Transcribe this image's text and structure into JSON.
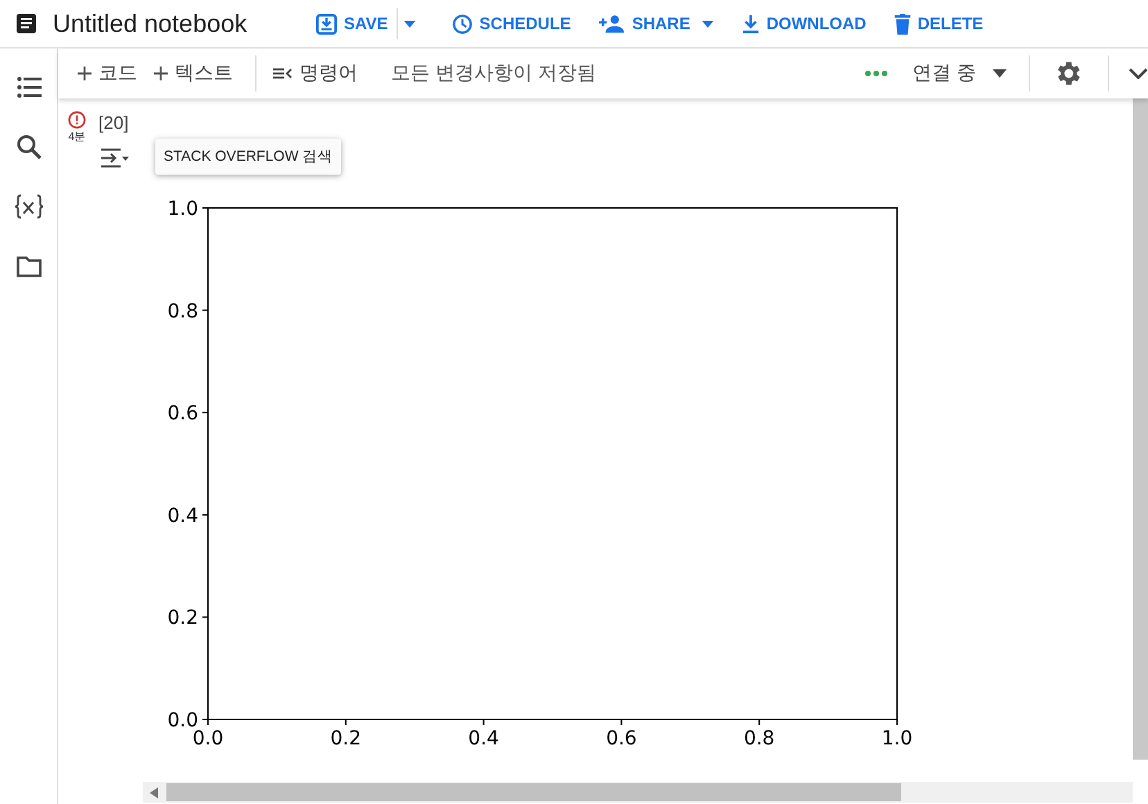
{
  "header": {
    "title": "Untitled notebook",
    "actions": [
      {
        "kind": "save",
        "label": "SAVE"
      },
      {
        "kind": "schedule",
        "label": "SCHEDULE"
      },
      {
        "kind": "share",
        "label": "SHARE"
      },
      {
        "kind": "download",
        "label": "DOWNLOAD"
      },
      {
        "kind": "delete",
        "label": "DELETE"
      }
    ]
  },
  "toolbar": {
    "add_code": "코드",
    "add_text": "텍스트",
    "commands": "명령어",
    "save_status": "모든 변경사항이 저장됨",
    "connection": "연결 중"
  },
  "cell": {
    "execution_count": "[20]",
    "time": "4분",
    "tooltip": "STACK OVERFLOW 검색",
    "chart_data": {
      "type": "line",
      "xlim": [
        0,
        1
      ],
      "ylim": [
        0,
        1
      ],
      "xticks": [
        {
          "value": 0,
          "label": "0.0"
        },
        {
          "value": 0.2,
          "label": "0.2"
        },
        {
          "value": 0.4,
          "label": "0.4"
        },
        {
          "value": 0.6,
          "label": "0.6"
        },
        {
          "value": 0.8,
          "label": "0.8"
        },
        {
          "value": 1,
          "label": "1.0"
        }
      ],
      "yticks": [
        {
          "value": 0,
          "label": "0.0"
        },
        {
          "value": 0.2,
          "label": "0.2"
        },
        {
          "value": 0.4,
          "label": "0.4"
        },
        {
          "value": 0.6,
          "label": "0.6"
        },
        {
          "value": 0.8,
          "label": "0.8"
        },
        {
          "value": 1,
          "label": "1.0"
        }
      ]
    }
  }
}
